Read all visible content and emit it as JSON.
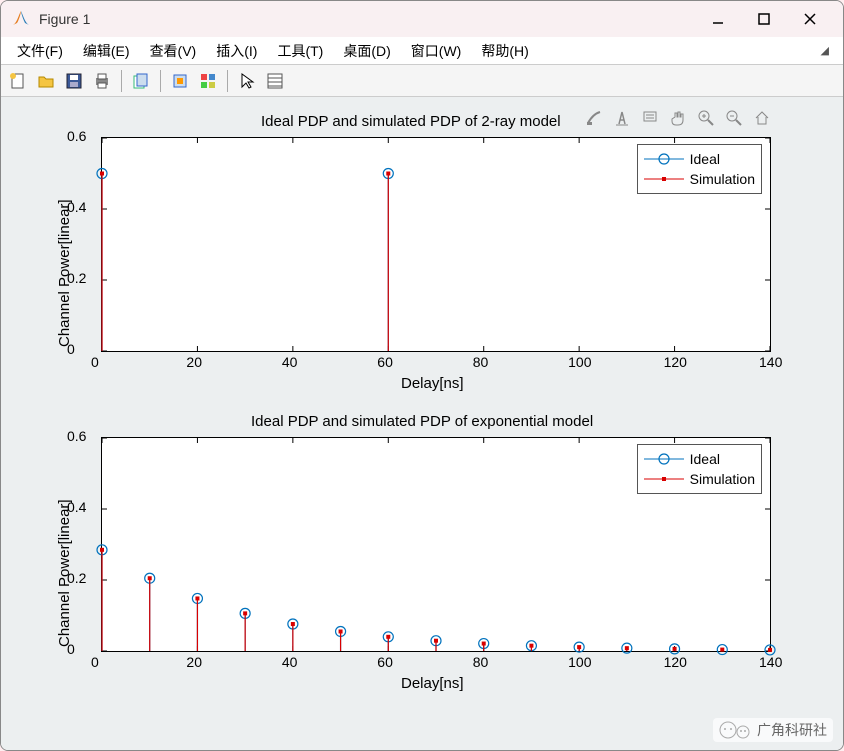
{
  "window": {
    "title": "Figure 1"
  },
  "menus": {
    "file": "文件(F)",
    "edit": "编辑(E)",
    "view": "查看(V)",
    "insert": "插入(I)",
    "tools": "工具(T)",
    "desktop": "桌面(D)",
    "window": "窗口(W)",
    "help": "帮助(H)"
  },
  "toolbar": {
    "new": "new-figure",
    "open": "open-file",
    "save": "save-figure",
    "print": "print-figure",
    "copy": "copy-figure",
    "link": "link-plot",
    "palette": "color-palette",
    "arrow": "edit-pointer",
    "props": "plot-tools"
  },
  "figtoolbar": {
    "brush": "brush-icon",
    "mark": "text-annotate-icon",
    "tips": "data-tips-icon",
    "pan": "pan-icon",
    "zoomin": "zoom-in-icon",
    "zoomout": "zoom-out-icon",
    "home": "home-icon"
  },
  "chart_data": [
    {
      "type": "stem",
      "title": "Ideal PDP and simulated PDP of 2-ray model",
      "xlabel": "Delay[ns]",
      "ylabel": "Channel Power[linear]",
      "xlim": [
        0,
        140
      ],
      "ylim": [
        0,
        0.6
      ],
      "xticks": [
        0,
        20,
        40,
        60,
        80,
        100,
        120,
        140
      ],
      "yticks": [
        0,
        0.2,
        0.4,
        0.6
      ],
      "legend": [
        "Ideal",
        "Simulation"
      ],
      "series": [
        {
          "name": "Ideal",
          "color": "#0072bd",
          "marker": "circle-open",
          "x": [
            0,
            60
          ],
          "y": [
            0.5,
            0.5
          ]
        },
        {
          "name": "Simulation",
          "color": "#d90000",
          "marker": "dot",
          "x": [
            0,
            60
          ],
          "y": [
            0.5,
            0.5
          ]
        }
      ]
    },
    {
      "type": "stem",
      "title": "Ideal PDP and simulated PDP of exponential model",
      "xlabel": "Delay[ns]",
      "ylabel": "Channel Power[linear]",
      "xlim": [
        0,
        140
      ],
      "ylim": [
        0,
        0.6
      ],
      "xticks": [
        0,
        20,
        40,
        60,
        80,
        100,
        120,
        140
      ],
      "yticks": [
        0,
        0.2,
        0.4,
        0.6
      ],
      "legend": [
        "Ideal",
        "Simulation"
      ],
      "series": [
        {
          "name": "Ideal",
          "color": "#0072bd",
          "marker": "circle-open",
          "x": [
            0,
            10,
            20,
            30,
            40,
            50,
            60,
            70,
            80,
            90,
            100,
            110,
            120,
            130,
            140
          ],
          "y": [
            0.285,
            0.205,
            0.148,
            0.106,
            0.076,
            0.055,
            0.04,
            0.029,
            0.021,
            0.015,
            0.011,
            0.008,
            0.006,
            0.004,
            0.003
          ]
        },
        {
          "name": "Simulation",
          "color": "#d90000",
          "marker": "dot",
          "x": [
            0,
            10,
            20,
            30,
            40,
            50,
            60,
            70,
            80,
            90,
            100,
            110,
            120,
            130,
            140
          ],
          "y": [
            0.285,
            0.205,
            0.148,
            0.106,
            0.076,
            0.055,
            0.04,
            0.029,
            0.021,
            0.015,
            0.011,
            0.008,
            0.006,
            0.004,
            0.003
          ]
        }
      ]
    }
  ],
  "watermark": {
    "text": "广角科研社"
  }
}
